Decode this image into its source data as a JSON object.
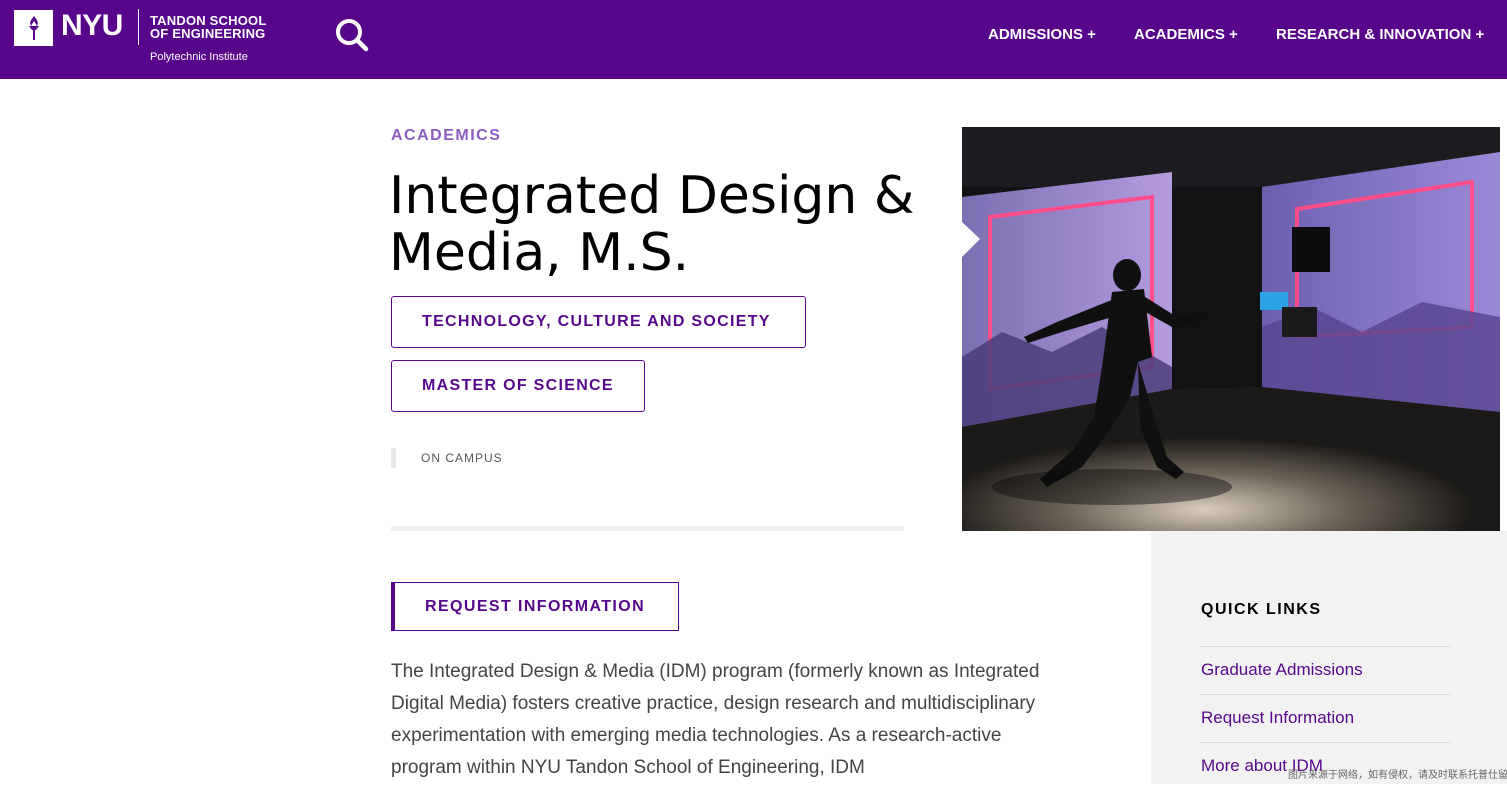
{
  "header": {
    "logo_wordmark": "NYU",
    "school_line1": "TANDON SCHOOL",
    "school_line2": "OF ENGINEERING",
    "school_sub": "Polytechnic Institute",
    "nav": [
      {
        "label": "ADMISSIONS +"
      },
      {
        "label": "ACADEMICS +"
      },
      {
        "label": "RESEARCH & INNOVATION +"
      }
    ],
    "icons": [
      "nyu-torch-icon",
      "search-icon"
    ]
  },
  "main": {
    "eyebrow": "ACADEMICS",
    "title": "Integrated Design & Media, M.S.",
    "tags": [
      "TECHNOLOGY, CULTURE AND SOCIETY",
      "MASTER OF SCIENCE"
    ],
    "delivery": "ON CAMPUS",
    "request_button": "REQUEST INFORMATION",
    "description": "The Integrated Design & Media (IDM) program (formerly known as Integrated Digital Media) fosters creative practice, design research and multidisciplinary experimentation with emerging media technologies. As a research-active program within NYU Tandon School of Engineering, IDM"
  },
  "quick_links": {
    "title": "QUICK LINKS",
    "items": [
      "Graduate Admissions",
      "Request Information",
      "More about IDM"
    ]
  },
  "watermark": "图片来源于网络，如有侵权，请及时联系托普仕留学删除",
  "colors": {
    "brand_purple": "#57068c",
    "eyebrow_purple": "#8c5cc0",
    "aside_bg": "#f2f2f2"
  }
}
